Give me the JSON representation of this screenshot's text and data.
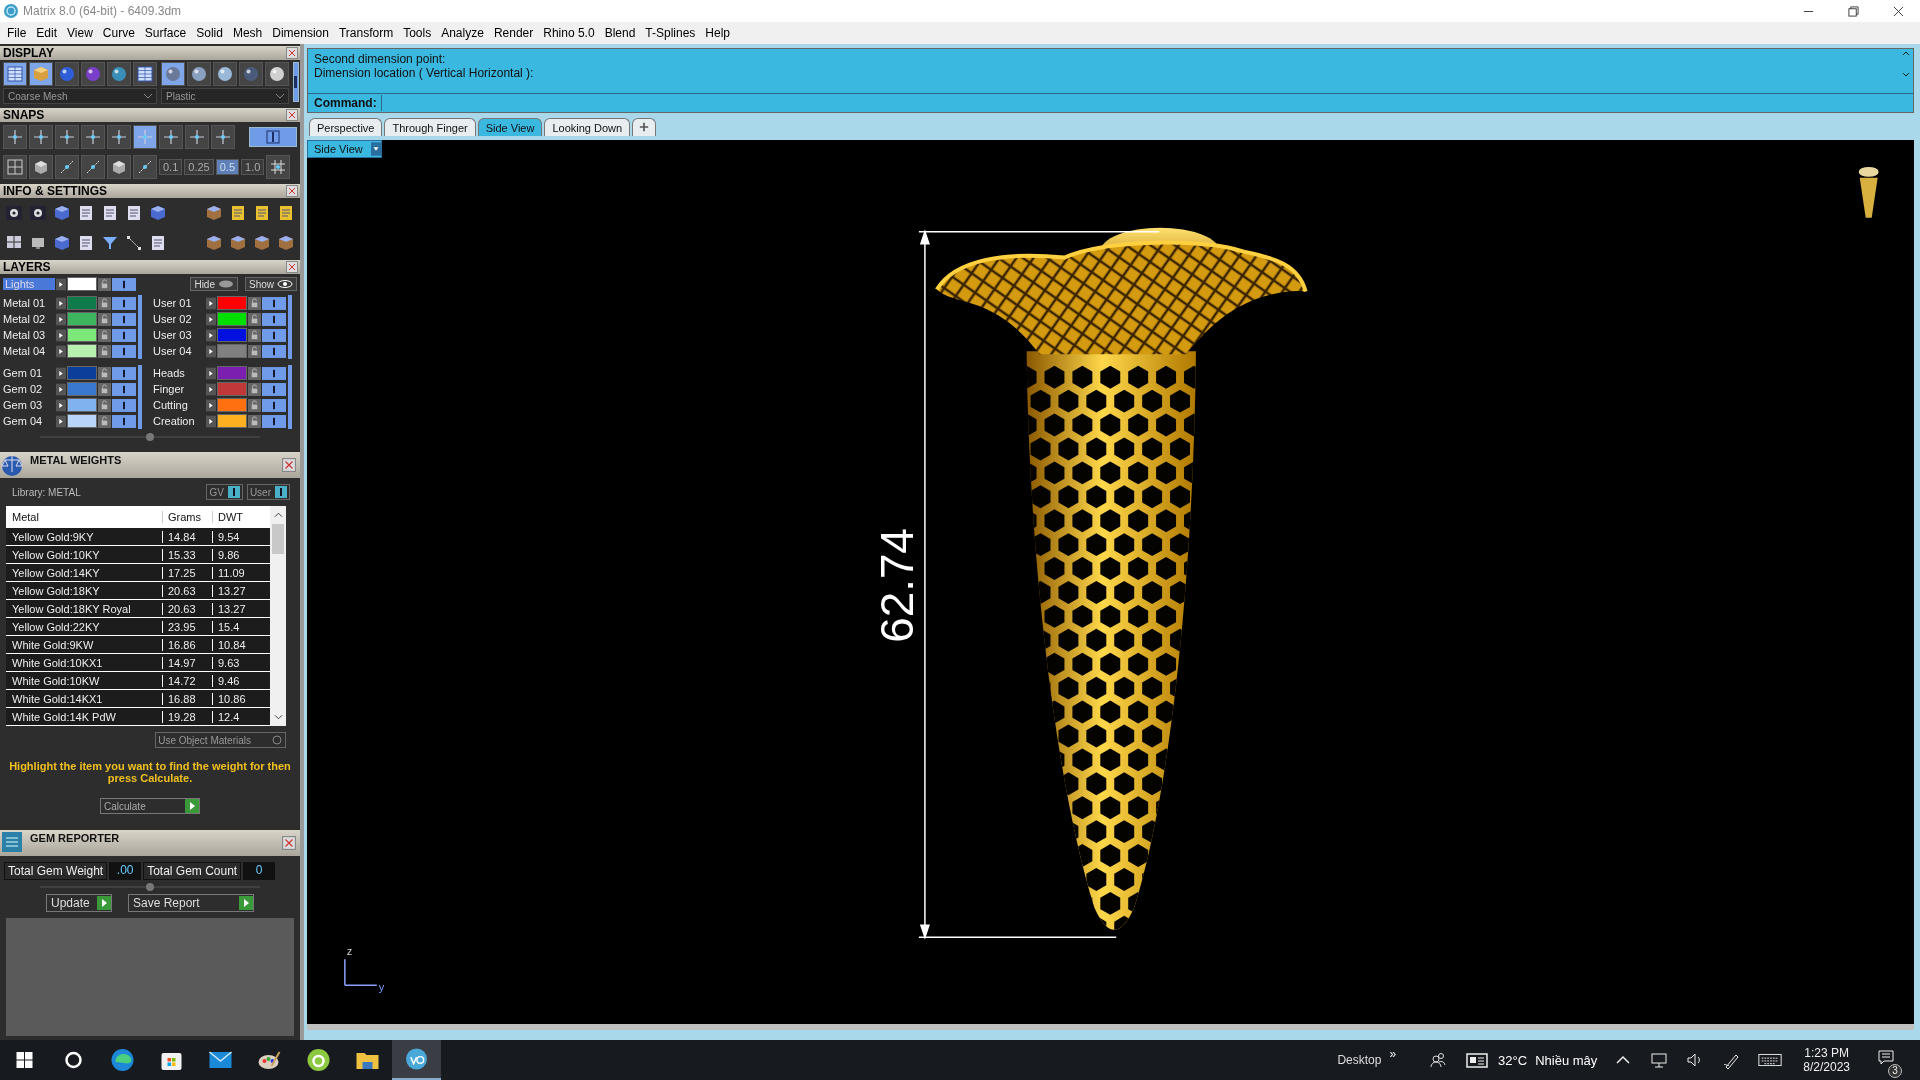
{
  "window": {
    "title": "Matrix 8.0 (64-bit) - 6409.3dm"
  },
  "menu": [
    "File",
    "Edit",
    "View",
    "Curve",
    "Surface",
    "Solid",
    "Mesh",
    "Dimension",
    "Transform",
    "Tools",
    "Analyze",
    "Render",
    "Rhino 5.0",
    "Blend",
    "T-Splines",
    "Help"
  ],
  "display": {
    "title": "DISPLAY",
    "mesh": "Coarse Mesh",
    "material": "Plastic",
    "toggle_on": true
  },
  "snaps": {
    "title": "SNAPS",
    "toggle_on": true,
    "increments": [
      {
        "label": "0.1",
        "selected": false
      },
      {
        "label": "0.25",
        "selected": false
      },
      {
        "label": "0.5",
        "selected": true
      },
      {
        "label": "1.0",
        "selected": false
      }
    ]
  },
  "info": {
    "title": "INFO & SETTINGS"
  },
  "layers": {
    "title": "LAYERS",
    "hide": "Hide",
    "show": "Show",
    "lights": {
      "name": "Lights",
      "color": "#ffffff",
      "selected": true
    },
    "items": [
      {
        "name": "Metal 01",
        "color": "#0f7a4a",
        "selected": false
      },
      {
        "name": "Metal 02",
        "color": "#3cb55e",
        "selected": false
      },
      {
        "name": "Metal 03",
        "color": "#7de87a",
        "selected": false
      },
      {
        "name": "Metal 04",
        "color": "#b8f0b0",
        "selected": false
      },
      {
        "name": "Gem 01",
        "color": "#0b3e9a",
        "selected": false
      },
      {
        "name": "Gem 02",
        "color": "#3a78d0",
        "selected": false
      },
      {
        "name": "Gem 03",
        "color": "#7fb2ee",
        "selected": false
      },
      {
        "name": "Gem 04",
        "color": "#b8d4f6",
        "selected": false
      },
      {
        "name": "User 01",
        "color": "#ff0000",
        "selected": false
      },
      {
        "name": "User 02",
        "color": "#00e000",
        "selected": false
      },
      {
        "name": "User 03",
        "color": "#0010e0",
        "selected": false
      },
      {
        "name": "User 04",
        "color": "#808080",
        "selected": false
      },
      {
        "name": "Heads",
        "color": "#7a1fb0",
        "selected": false
      },
      {
        "name": "Finger",
        "color": "#c03838",
        "selected": false
      },
      {
        "name": "Cutting",
        "color": "#ff7010",
        "selected": false
      },
      {
        "name": "Creation",
        "color": "#ffb020",
        "selected": false
      }
    ]
  },
  "metal_weights": {
    "title": "METAL WEIGHTS",
    "library": "Library: METAL",
    "toggles": [
      "GV",
      "User"
    ],
    "columns": [
      "Metal",
      "Grams",
      "DWT"
    ],
    "rows": [
      [
        "Yellow Gold:9KY",
        "14.84",
        "9.54"
      ],
      [
        "Yellow Gold:10KY",
        "15.33",
        "9.86"
      ],
      [
        "Yellow Gold:14KY",
        "17.25",
        "11.09"
      ],
      [
        "Yellow Gold:18KY",
        "20.63",
        "13.27"
      ],
      [
        "Yellow Gold:18KY Royal",
        "20.63",
        "13.27"
      ],
      [
        "Yellow Gold:22KY",
        "23.95",
        "15.4"
      ],
      [
        "White Gold:9KW",
        "16.86",
        "10.84"
      ],
      [
        "White Gold:10KX1",
        "14.97",
        "9.63"
      ],
      [
        "White Gold:10KW",
        "14.72",
        "9.46"
      ],
      [
        "White Gold:14KX1",
        "16.88",
        "10.86"
      ],
      [
        "White Gold:14K PdW",
        "19.28",
        "12.4"
      ]
    ],
    "use_object_materials": "Use Object Materials",
    "hint": "Highlight the item you want to find the weight for then press Calculate.",
    "calculate": "Calculate"
  },
  "gem_reporter": {
    "title": "GEM REPORTER",
    "weight_label": "Total Gem Weight",
    "weight": ".00",
    "count_label": "Total Gem Count",
    "count": "0",
    "buttons": [
      "Update",
      "Save Report"
    ]
  },
  "command": {
    "history": [
      "Second dimension point:",
      "Dimension location ( Vertical  Horizontal ):"
    ],
    "prompt": "Command:"
  },
  "tabs": [
    {
      "label": "Perspective",
      "selected": false
    },
    {
      "label": "Through Finger",
      "selected": false
    },
    {
      "label": "Side View",
      "selected": true
    },
    {
      "label": "Looking Down",
      "selected": false
    }
  ],
  "viewport": {
    "label": "Side View",
    "dimension": "62.74",
    "axes": [
      "z",
      "y"
    ]
  },
  "taskbar": {
    "desktop": "Desktop",
    "more": "»",
    "temperature": "32°C",
    "weather": "Nhiều mây",
    "time": "1:23 PM",
    "date": "8/2/2023",
    "notifications": "3"
  }
}
